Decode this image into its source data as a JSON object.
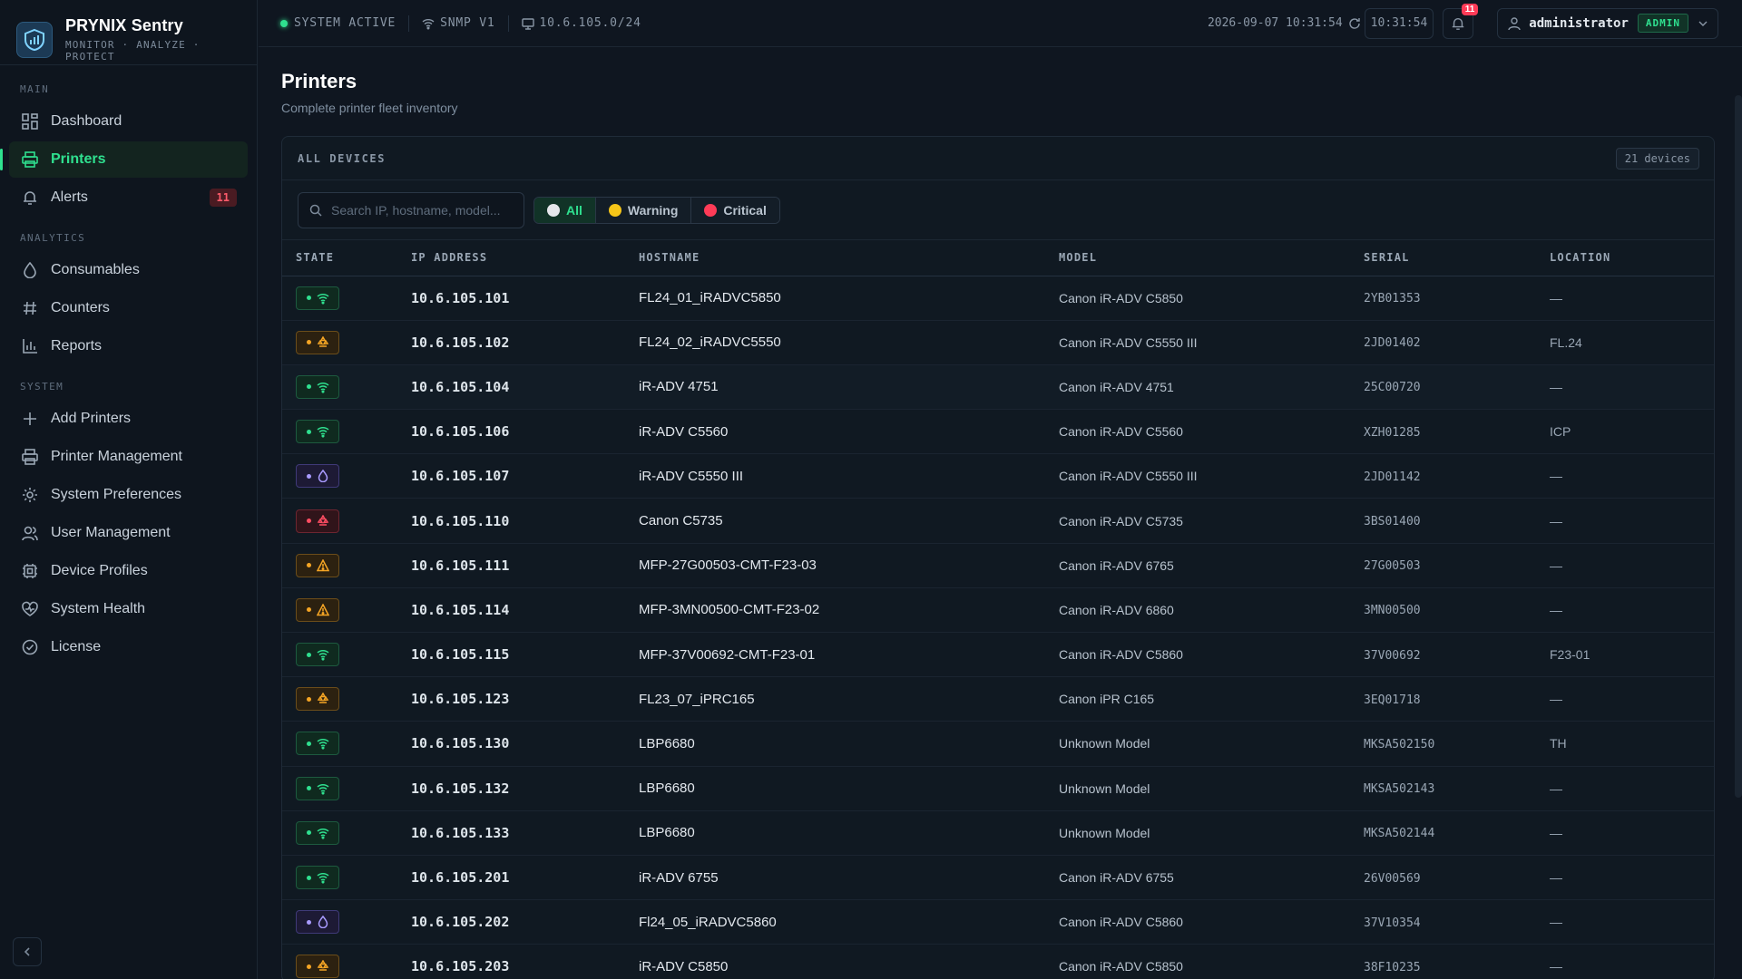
{
  "brand": {
    "name": "PRYNIX Sentry",
    "tagline": "MONITOR · ANALYZE · PROTECT"
  },
  "sidebar": {
    "sections": [
      {
        "label": "MAIN",
        "items": [
          {
            "label": "Dashboard",
            "icon": "dashboard-icon"
          },
          {
            "label": "Printers",
            "icon": "printer-icon",
            "active": true
          },
          {
            "label": "Alerts",
            "icon": "bell-icon",
            "badge": "11"
          }
        ]
      },
      {
        "label": "ANALYTICS",
        "items": [
          {
            "label": "Consumables",
            "icon": "droplet-icon"
          },
          {
            "label": "Counters",
            "icon": "hash-icon"
          },
          {
            "label": "Reports",
            "icon": "bar-chart-icon"
          }
        ]
      },
      {
        "label": "SYSTEM",
        "items": [
          {
            "label": "Add Printers",
            "icon": "plus-icon"
          },
          {
            "label": "Printer Management",
            "icon": "printer-icon"
          },
          {
            "label": "System Preferences",
            "icon": "gear-icon"
          },
          {
            "label": "User Management",
            "icon": "users-icon"
          },
          {
            "label": "Device Profiles",
            "icon": "chip-icon"
          },
          {
            "label": "System Health",
            "icon": "heart-pulse-icon"
          },
          {
            "label": "License",
            "icon": "check-circle-icon"
          }
        ]
      }
    ]
  },
  "topbar": {
    "status": "SYSTEM ACTIVE",
    "protocol": "SNMP V1",
    "subnet": "10.6.105.0/24",
    "datetime": "2026-09-07 10:31:54",
    "refresh_time": "10:31:54",
    "notifications": "11",
    "user": "administrator",
    "role": "ADMIN"
  },
  "page": {
    "title": "Printers",
    "subtitle": "Complete printer fleet inventory"
  },
  "panel": {
    "title": "ALL DEVICES",
    "count": "21 devices",
    "search_placeholder": "Search IP, hostname, model...",
    "filters": [
      {
        "label": "All",
        "color": "#e5e7eb",
        "active": true
      },
      {
        "label": "Warning",
        "color": "#f5c518"
      },
      {
        "label": "Critical",
        "color": "#ff3b57"
      }
    ]
  },
  "table": {
    "columns": [
      "STATE",
      "IP ADDRESS",
      "HOSTNAME",
      "MODEL",
      "SERIAL",
      "LOCATION"
    ],
    "rows": [
      {
        "state": "ok",
        "ip": "10.6.105.101",
        "host": "FL24_01_iRADVC5850",
        "model": "Canon iR-ADV C5850",
        "serial": "2YB01353",
        "location": "—"
      },
      {
        "state": "toner",
        "ip": "10.6.105.102",
        "host": "FL24_02_iRADVC5550",
        "model": "Canon iR-ADV C5550 III",
        "serial": "2JD01402",
        "location": "FL.24"
      },
      {
        "state": "ok",
        "ip": "10.6.105.104",
        "host": "iR-ADV 4751",
        "model": "Canon iR-ADV 4751",
        "serial": "25C00720",
        "location": "—"
      },
      {
        "state": "ok",
        "ip": "10.6.105.106",
        "host": "iR-ADV C5560",
        "model": "Canon iR-ADV C5560",
        "serial": "XZH01285",
        "location": "ICP"
      },
      {
        "state": "ink",
        "ip": "10.6.105.107",
        "host": "iR-ADV C5550 III",
        "model": "Canon iR-ADV C5550 III",
        "serial": "2JD01142",
        "location": "—"
      },
      {
        "state": "crit",
        "ip": "10.6.105.110",
        "host": "Canon C5735",
        "model": "Canon iR-ADV C5735",
        "serial": "3BS01400",
        "location": "—"
      },
      {
        "state": "warn",
        "ip": "10.6.105.111",
        "host": "MFP-27G00503-CMT-F23-03",
        "model": "Canon iR-ADV 6765",
        "serial": "27G00503",
        "location": "—"
      },
      {
        "state": "warn",
        "ip": "10.6.105.114",
        "host": "MFP-3MN00500-CMT-F23-02",
        "model": "Canon iR-ADV 6860",
        "serial": "3MN00500",
        "location": "—"
      },
      {
        "state": "ok",
        "ip": "10.6.105.115",
        "host": "MFP-37V00692-CMT-F23-01",
        "model": "Canon iR-ADV C5860",
        "serial": "37V00692",
        "location": "F23-01"
      },
      {
        "state": "toner",
        "ip": "10.6.105.123",
        "host": "FL23_07_iPRC165",
        "model": "Canon iPR C165",
        "serial": "3EQ01718",
        "location": "—"
      },
      {
        "state": "ok",
        "ip": "10.6.105.130",
        "host": "LBP6680",
        "model": "Unknown Model",
        "serial": "MKSA502150",
        "location": "TH"
      },
      {
        "state": "ok",
        "ip": "10.6.105.132",
        "host": "LBP6680",
        "model": "Unknown Model",
        "serial": "MKSA502143",
        "location": "—"
      },
      {
        "state": "ok",
        "ip": "10.6.105.133",
        "host": "LBP6680",
        "model": "Unknown Model",
        "serial": "MKSA502144",
        "location": "—"
      },
      {
        "state": "ok",
        "ip": "10.6.105.201",
        "host": "iR-ADV 6755",
        "model": "Canon iR-ADV 6755",
        "serial": "26V00569",
        "location": "—"
      },
      {
        "state": "ink",
        "ip": "10.6.105.202",
        "host": "Fl24_05_iRADVC5860",
        "model": "Canon iR-ADV C5860",
        "serial": "37V10354",
        "location": "—"
      },
      {
        "state": "toner",
        "ip": "10.6.105.203",
        "host": "iR-ADV C5850",
        "model": "Canon iR-ADV C5850",
        "serial": "38F10235",
        "location": "—"
      }
    ]
  }
}
